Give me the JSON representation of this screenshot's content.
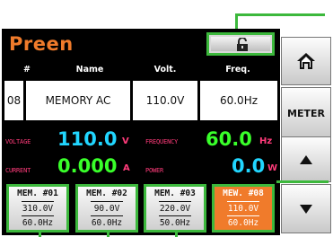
{
  "app": {
    "brand": "Preen"
  },
  "icons": {
    "lock": "unlocked-padlock-icon",
    "home": "home-icon",
    "up": "up-arrow-icon",
    "down": "down-arrow-icon"
  },
  "table": {
    "headers": [
      "#",
      "Name",
      "Volt.",
      "Freq."
    ],
    "row": {
      "index": "08",
      "name": "MEMORY AC",
      "volt": "110.0V",
      "freq": "60.0Hz"
    }
  },
  "meter": {
    "voltage_label": "VOLTAGE",
    "voltage_value": "110.0",
    "voltage_unit": "V",
    "frequency_label": "FREQUENCY",
    "frequency_value": "60.0",
    "frequency_unit": "Hz",
    "current_label": "CURRENT",
    "current_value": "0.000",
    "current_unit": "A",
    "power_label": "POWER",
    "power_value": "0.0",
    "power_unit": "W"
  },
  "memories": [
    {
      "title": "MEM. #01",
      "volt": "310.0V",
      "freq": "60.0Hz",
      "selected": false
    },
    {
      "title": "MEM. #02",
      "volt": "90.0V",
      "freq": "60.0Hz",
      "selected": false
    },
    {
      "title": "MEM. #03",
      "volt": "220.0V",
      "freq": "50.0Hz",
      "selected": false
    },
    {
      "title": "MEW. #08",
      "volt": "110.0V",
      "freq": "60.0Hz",
      "selected": true
    }
  ],
  "side_buttons": {
    "meter_label": "METER"
  },
  "colors": {
    "accent_orange": "#f07b2b",
    "value_cyan": "#21d6ff",
    "label_pink": "#ff3b7a",
    "callout_green": "#3cb83c",
    "panel_black": "#000000"
  }
}
